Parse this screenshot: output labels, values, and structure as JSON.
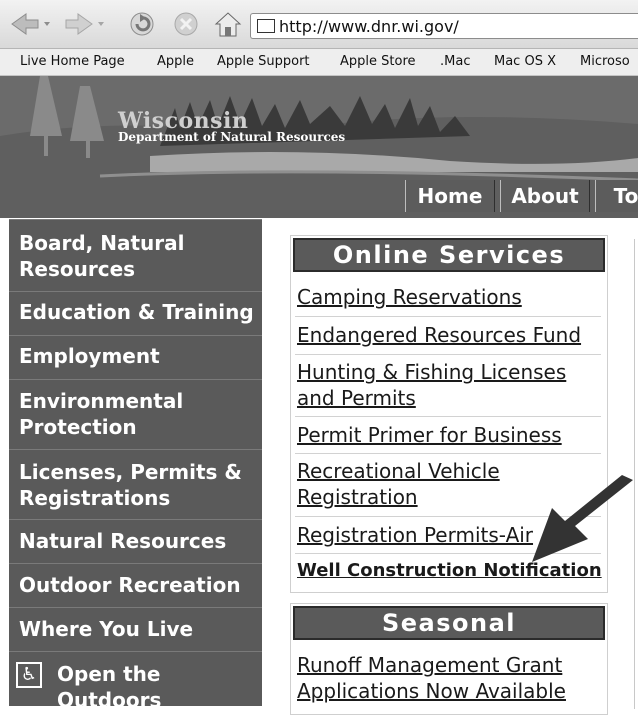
{
  "browser": {
    "url": "http://www.dnr.wi.gov/",
    "bookmarks": [
      "Live Home Page",
      "Apple",
      "Apple Support",
      "Apple Store",
      ".Mac",
      "Mac OS X",
      "Microso"
    ]
  },
  "banner": {
    "state": "Wisconsin",
    "department": "Department of Natural Resources",
    "tabs": [
      "Home",
      "About",
      "To"
    ]
  },
  "sidebar": {
    "items": [
      {
        "label": "Board, Natural Resources"
      },
      {
        "label": "Education & Training"
      },
      {
        "label": "Employment"
      },
      {
        "label": "Environmental Protection"
      },
      {
        "label": "Licenses, Permits & Registrations"
      },
      {
        "label": "Natural Resources"
      },
      {
        "label": "Outdoor Recreation"
      },
      {
        "label": "Where You Live"
      },
      {
        "label": "Open the Outdoors"
      }
    ]
  },
  "online_services": {
    "title": "Online Services",
    "links": [
      "Camping Reservations",
      "Endangered Resources Fund",
      "Hunting & Fishing Licenses and Permits",
      "Permit Primer for Business",
      "Recreational Vehicle Registration",
      "Registration Permits-Air",
      "Well Construction Notification"
    ]
  },
  "seasonal": {
    "title": "Seasonal",
    "links": [
      "Runoff Management Grant Applications Now Available"
    ]
  },
  "colors": {
    "sidebar_bg": "#5a5a5a",
    "header_bg": "#5a5a5a",
    "link": "#1a1a1a"
  },
  "icons": [
    "back-icon",
    "forward-icon",
    "reload-icon",
    "stop-icon",
    "home-icon",
    "accessibility-icon",
    "arrow-annotation-icon"
  ]
}
